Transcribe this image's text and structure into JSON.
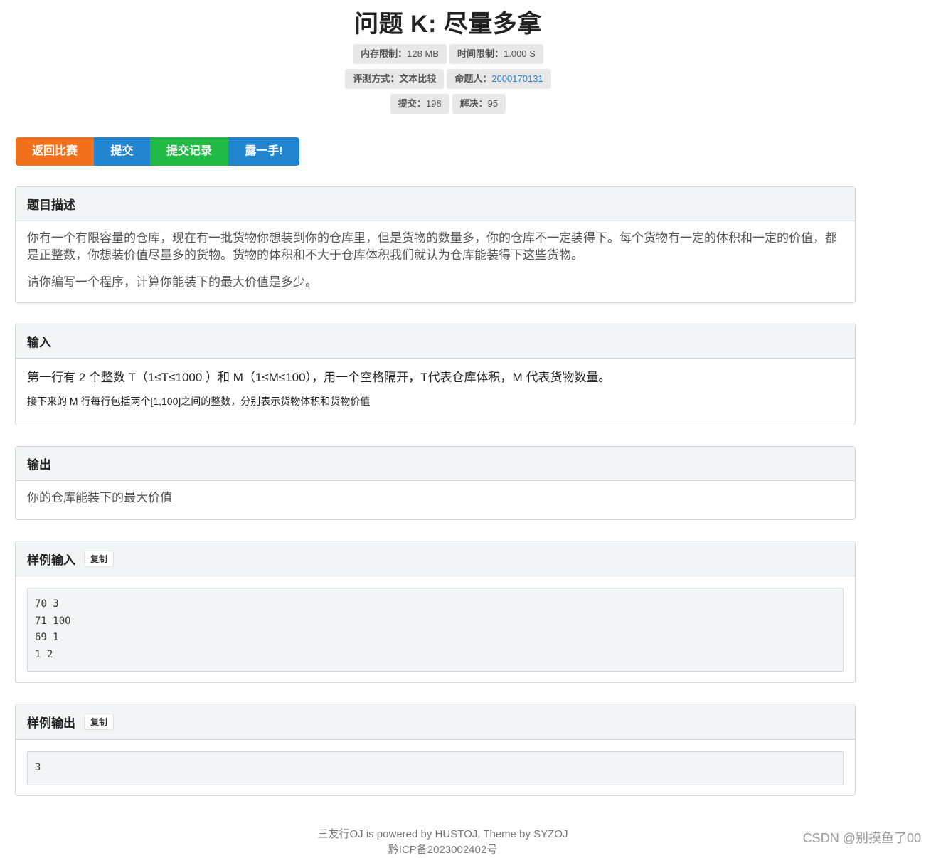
{
  "page": {
    "title": "问题 K: 尽量多拿"
  },
  "labels": {
    "memory_key": "内存限制：",
    "memory_value": "128 MB",
    "time_key": "时间限制：",
    "time_value": "1.000 S",
    "judge_key": "评测方式：",
    "judge_value": "文本比较",
    "author_key": "命题人：",
    "author_value": "2000170131",
    "submit_key": "提交：",
    "submit_value": "198",
    "solved_key": "解决：",
    "solved_value": "95"
  },
  "buttons": {
    "back": "返回比赛",
    "submit": "提交",
    "records": "提交记录",
    "show": "露一手!"
  },
  "description": {
    "heading": "题目描述",
    "p1": "你有一个有限容量的仓库，现在有一批货物你想装到你的仓库里，但是货物的数量多，你的仓库不一定装得下。每个货物有一定的体积和一定的价值，都是正整数，你想装价值尽量多的货物。货物的体积和不大于仓库体积我们就认为仓库能装得下这些货物。",
    "p2": "请你编写一个程序，计算你能装下的最大价值是多少。"
  },
  "input": {
    "heading": "输入",
    "line1": "第一行有 2 个整数 T（1≤T≤1000 ）和 M（1≤M≤100），用一个空格隔开，T代表仓库体积，M 代表货物数量。",
    "line2": "接下来的 M 行每行包括两个[1,100]之间的整数，分别表示货物体积和货物价值"
  },
  "output": {
    "heading": "输出",
    "text": "你的仓库能装下的最大价值"
  },
  "sample_input": {
    "heading": "样例输入",
    "copy": "复制",
    "code": "70 3\n71 100\n69 1\n1 2"
  },
  "sample_output": {
    "heading": "样例输出",
    "copy": "复制",
    "code": "3"
  },
  "footer": {
    "line1": "三友行OJ is powered by HUSTOJ, Theme by SYZOJ",
    "line2": "黔ICP备2023002402号"
  },
  "watermark": "CSDN @别摸鱼了00",
  "colors": {
    "orange": "#f2711c",
    "blue": "#2185d0",
    "green": "#21ba45",
    "link": "#2b7bc4"
  }
}
